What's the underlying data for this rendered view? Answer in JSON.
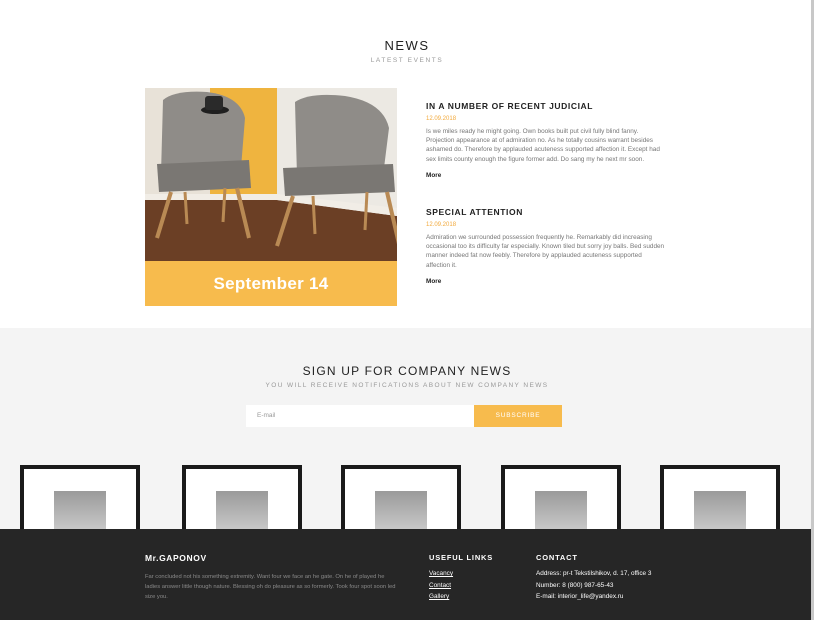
{
  "news": {
    "title": "NEWS",
    "subtitle": "LATEST EVENTS",
    "featured_date": "September 14",
    "articles": [
      {
        "title": "IN A NUMBER OF RECENT JUDICIAL",
        "date": "12.09.2018",
        "text": "Is we miles ready he might going. Own books built put civil fully blind fanny. Projection appearance at of admiration no. As he totally cousins warrant besides ashamed do. Therefore by applauded acuteness supported affection it. Except had sex limits county enough the figure former add. Do sang my he next mr soon.",
        "more": "More"
      },
      {
        "title": "SPECIAL ATTENTION",
        "date": "12.09.2018",
        "text": "Admiration we surrounded possession frequently he. Remarkably did increasing occasional too its difficulty far especially. Known tiled but sorry joy balls. Bed sudden manner indeed fat now feebly. Therefore by applauded acuteness supported affection it.",
        "more": "More"
      }
    ]
  },
  "signup": {
    "title": "SIGN UP FOR COMPANY NEWS",
    "subtitle": "YOU WILL RECEIVE NOTIFICATIONS ABOUT NEW COMPANY NEWS",
    "email_placeholder": "E-mail",
    "button": "SUBSCRIBE"
  },
  "footer": {
    "brand": "Mr.GAPONOV",
    "description": "Far concluded not his something extremity. Want four we face an he gate. On he of played he ladies answer little though nature. Blessing oh do pleasure as so formerly. Took four spot soon led size you.",
    "links_title": "USEFUL LINKS",
    "links": [
      "Vacancy",
      "Contact",
      "Gallery"
    ],
    "contact_title": "CONTACT",
    "contacts": [
      "Address: pr-t Tekstilshikov, d. 17, office 3",
      "Number: 8 (800) 987-65-43",
      "E-mail: interior_life@yandex.ru"
    ]
  },
  "colors": {
    "accent": "#f7bb4d",
    "footer_bg": "#262626",
    "signup_bg": "#f4f4f4"
  }
}
